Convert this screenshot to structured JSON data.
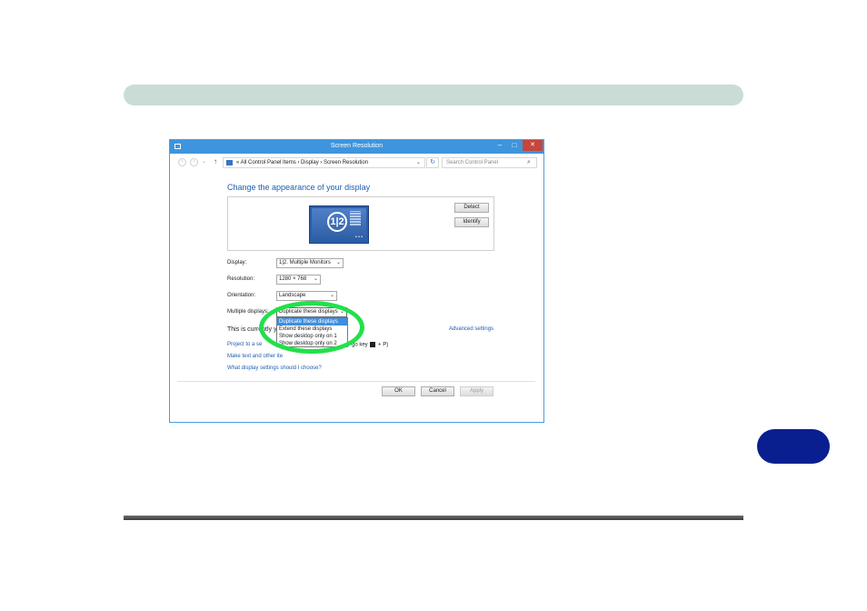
{
  "window": {
    "title": "Screen Resolution",
    "controls": {
      "minimize": "–",
      "maximize": "□",
      "close": "✕"
    }
  },
  "addressbar": {
    "path": "« All Control Panel Items › Display › Screen Resolution",
    "search_placeholder": "Search Control Panel"
  },
  "main": {
    "heading": "Change the appearance of your display",
    "monitor_label": "1|2",
    "detect_label": "Detect",
    "identify_label": "Identify",
    "display_label": "Display:",
    "display_value": "1|2. Multiple Monitors",
    "resolution_label": "Resolution:",
    "resolution_value": "1280 × 768",
    "orientation_label": "Orientation:",
    "orientation_value": "Landscape",
    "multiple_label": "Multiple displays:",
    "multiple_value": "Duplicate these displays",
    "multiple_options": [
      "Duplicate these displays",
      "Extend these displays",
      "Show desktop only on 1",
      "Show desktop only on 2"
    ],
    "current_text": "This is currently yo",
    "advanced_link": "Advanced settings",
    "project_link": "Project to a se",
    "project_tail_a": "go key",
    "project_tail_b": "+ P)",
    "text_link": "Make text and other ite",
    "what_link": "What display settings should I choose?"
  },
  "footer": {
    "ok": "OK",
    "cancel": "Cancel",
    "apply": "Apply"
  },
  "colors": {
    "header_band": "#c9dcd6",
    "chapter_tab": "#0a1f8f",
    "titlebar": "#3e95dd",
    "highlight_ring": "#22e04a",
    "link": "#1e5eaf"
  }
}
